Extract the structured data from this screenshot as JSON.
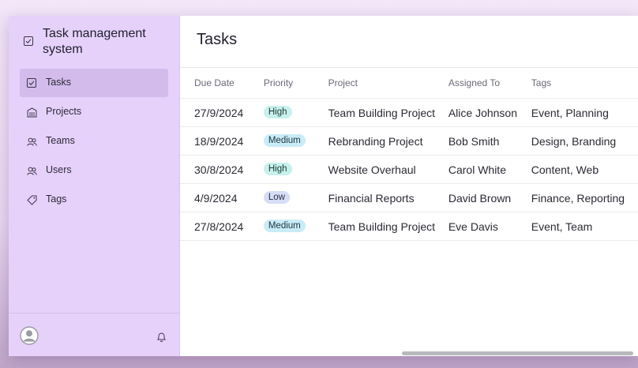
{
  "app": {
    "title": "Task management system"
  },
  "sidebar": {
    "items": [
      {
        "label": "Tasks",
        "icon": "checkbox-icon",
        "active": true
      },
      {
        "label": "Projects",
        "icon": "building-icon"
      },
      {
        "label": "Teams",
        "icon": "users-icon"
      },
      {
        "label": "Users",
        "icon": "users-icon"
      },
      {
        "label": "Tags",
        "icon": "tag-icon"
      }
    ]
  },
  "page": {
    "title": "Tasks"
  },
  "table": {
    "headers": [
      "Due Date",
      "Priority",
      "Project",
      "Assigned To",
      "Tags"
    ],
    "rows": [
      {
        "due": "27/9/2024",
        "priority": "High",
        "project": "Team Building Project",
        "assigned": "Alice Johnson",
        "tags": "Event, Planning"
      },
      {
        "due": "18/9/2024",
        "priority": "Medium",
        "project": "Rebranding Project",
        "assigned": "Bob Smith",
        "tags": "Design, Branding"
      },
      {
        "due": "30/8/2024",
        "priority": "High",
        "project": "Website Overhaul",
        "assigned": "Carol White",
        "tags": "Content, Web"
      },
      {
        "due": "4/9/2024",
        "priority": "Low",
        "project": "Financial Reports",
        "assigned": "David Brown",
        "tags": "Finance, Reporting"
      },
      {
        "due": "27/8/2024",
        "priority": "Medium",
        "project": "Team Building Project",
        "assigned": "Eve Davis",
        "tags": "Event, Team"
      }
    ]
  },
  "colors": {
    "sidebar_bg": "#e6d1fb",
    "active_item": "#d3bcec",
    "badge_high": "#c7f1ec",
    "badge_medium": "#c9ecf6",
    "badge_low": "#d6def5"
  }
}
